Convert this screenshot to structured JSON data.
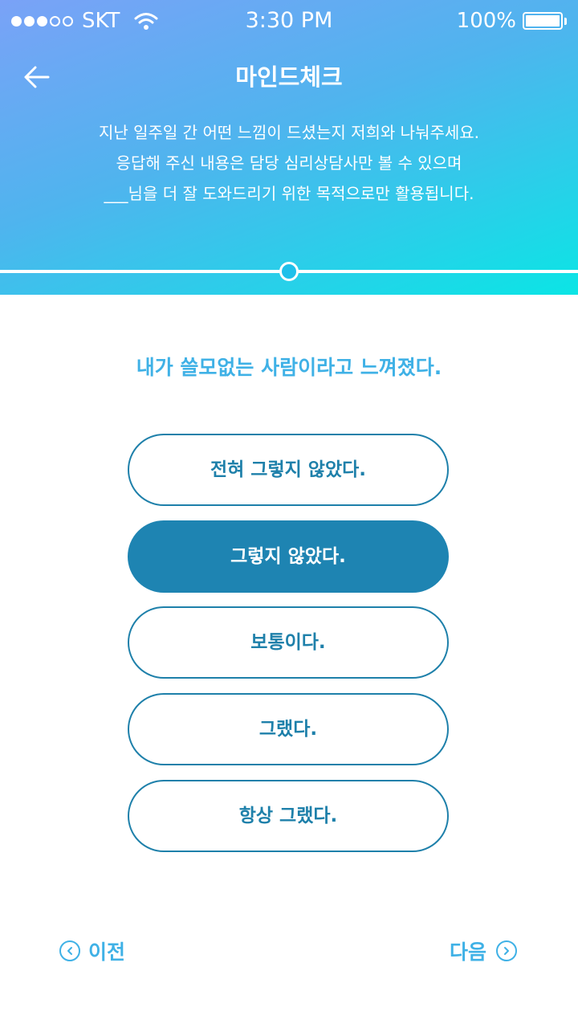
{
  "status_bar": {
    "carrier": "SKT",
    "time": "3:30 PM",
    "battery": "100%",
    "signal_bars": 3,
    "signal_total": 5
  },
  "nav": {
    "title": "마인드체크",
    "back_icon": "arrow-left-icon"
  },
  "intro": {
    "lines": [
      "지난 일주일 간 어떤 느낌이 드셨는지 저희와 나눠주세요.",
      "응답해 주신 내용은 담당 심리상담사만 볼 수 있으며",
      "___님을 더 잘 도와드리기 위한 목적으로만 활용됩니다."
    ]
  },
  "progress": {
    "fraction": 0.5
  },
  "question": "내가 쓸모없는 사람이라고 느껴졌다.",
  "options": [
    {
      "label": "전혀 그렇지 않았다.",
      "selected": false
    },
    {
      "label": "그렇지 않았다.",
      "selected": true
    },
    {
      "label": "보통이다.",
      "selected": false
    },
    {
      "label": "그랬다.",
      "selected": false
    },
    {
      "label": "항상 그랬다.",
      "selected": false
    }
  ],
  "footer": {
    "prev_label": "이전",
    "next_label": "다음",
    "prev_icon": "chevron-left-circle-icon",
    "next_icon": "chevron-right-circle-icon"
  },
  "colors": {
    "accent": "#3fb1e6",
    "primary": "#1e84b2",
    "header_gradient_start": "#7aa2f7",
    "header_gradient_end": "#0be5e5"
  }
}
